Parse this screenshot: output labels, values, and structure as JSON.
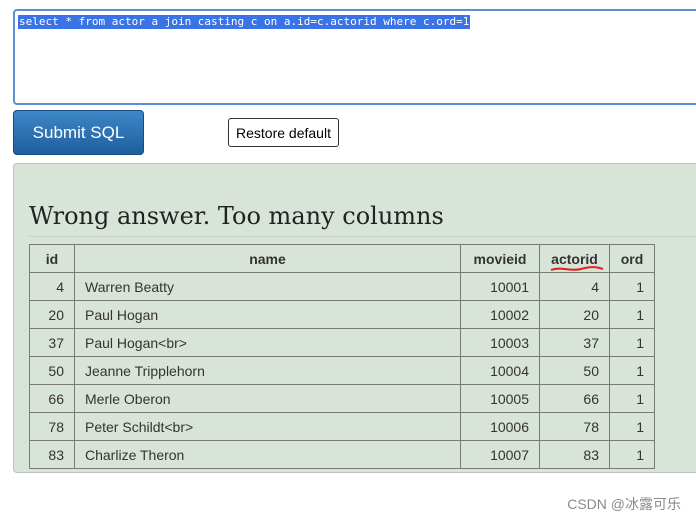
{
  "editor": {
    "query": "select * from actor a join casting c on a.id=c.actorid where c.ord=1"
  },
  "buttons": {
    "submit_label": "Submit SQL",
    "restore_label": "Restore default"
  },
  "result": {
    "message": "Wrong answer. Too many columns",
    "columns": [
      "id",
      "name",
      "movieid",
      "actorid",
      "ord"
    ],
    "rows": [
      [
        "4",
        "Warren Beatty",
        "10001",
        "4",
        "1"
      ],
      [
        "20",
        "Paul Hogan",
        "10002",
        "20",
        "1"
      ],
      [
        "37",
        "Paul Hogan<br>",
        "10003",
        "37",
        "1"
      ],
      [
        "50",
        "Jeanne Tripplehorn",
        "10004",
        "50",
        "1"
      ],
      [
        "66",
        "Merle Oberon",
        "10005",
        "66",
        "1"
      ],
      [
        "78",
        "Peter Schildt<br>",
        "10006",
        "78",
        "1"
      ],
      [
        "83",
        "Charlize Theron",
        "10007",
        "83",
        "1"
      ]
    ]
  },
  "watermark": "CSDN @冰露可乐",
  "colors": {
    "selection": "#3a73e6",
    "submit": "#2a6fb0",
    "panel": "#d9e4d9",
    "annotation": "#e0201e"
  }
}
